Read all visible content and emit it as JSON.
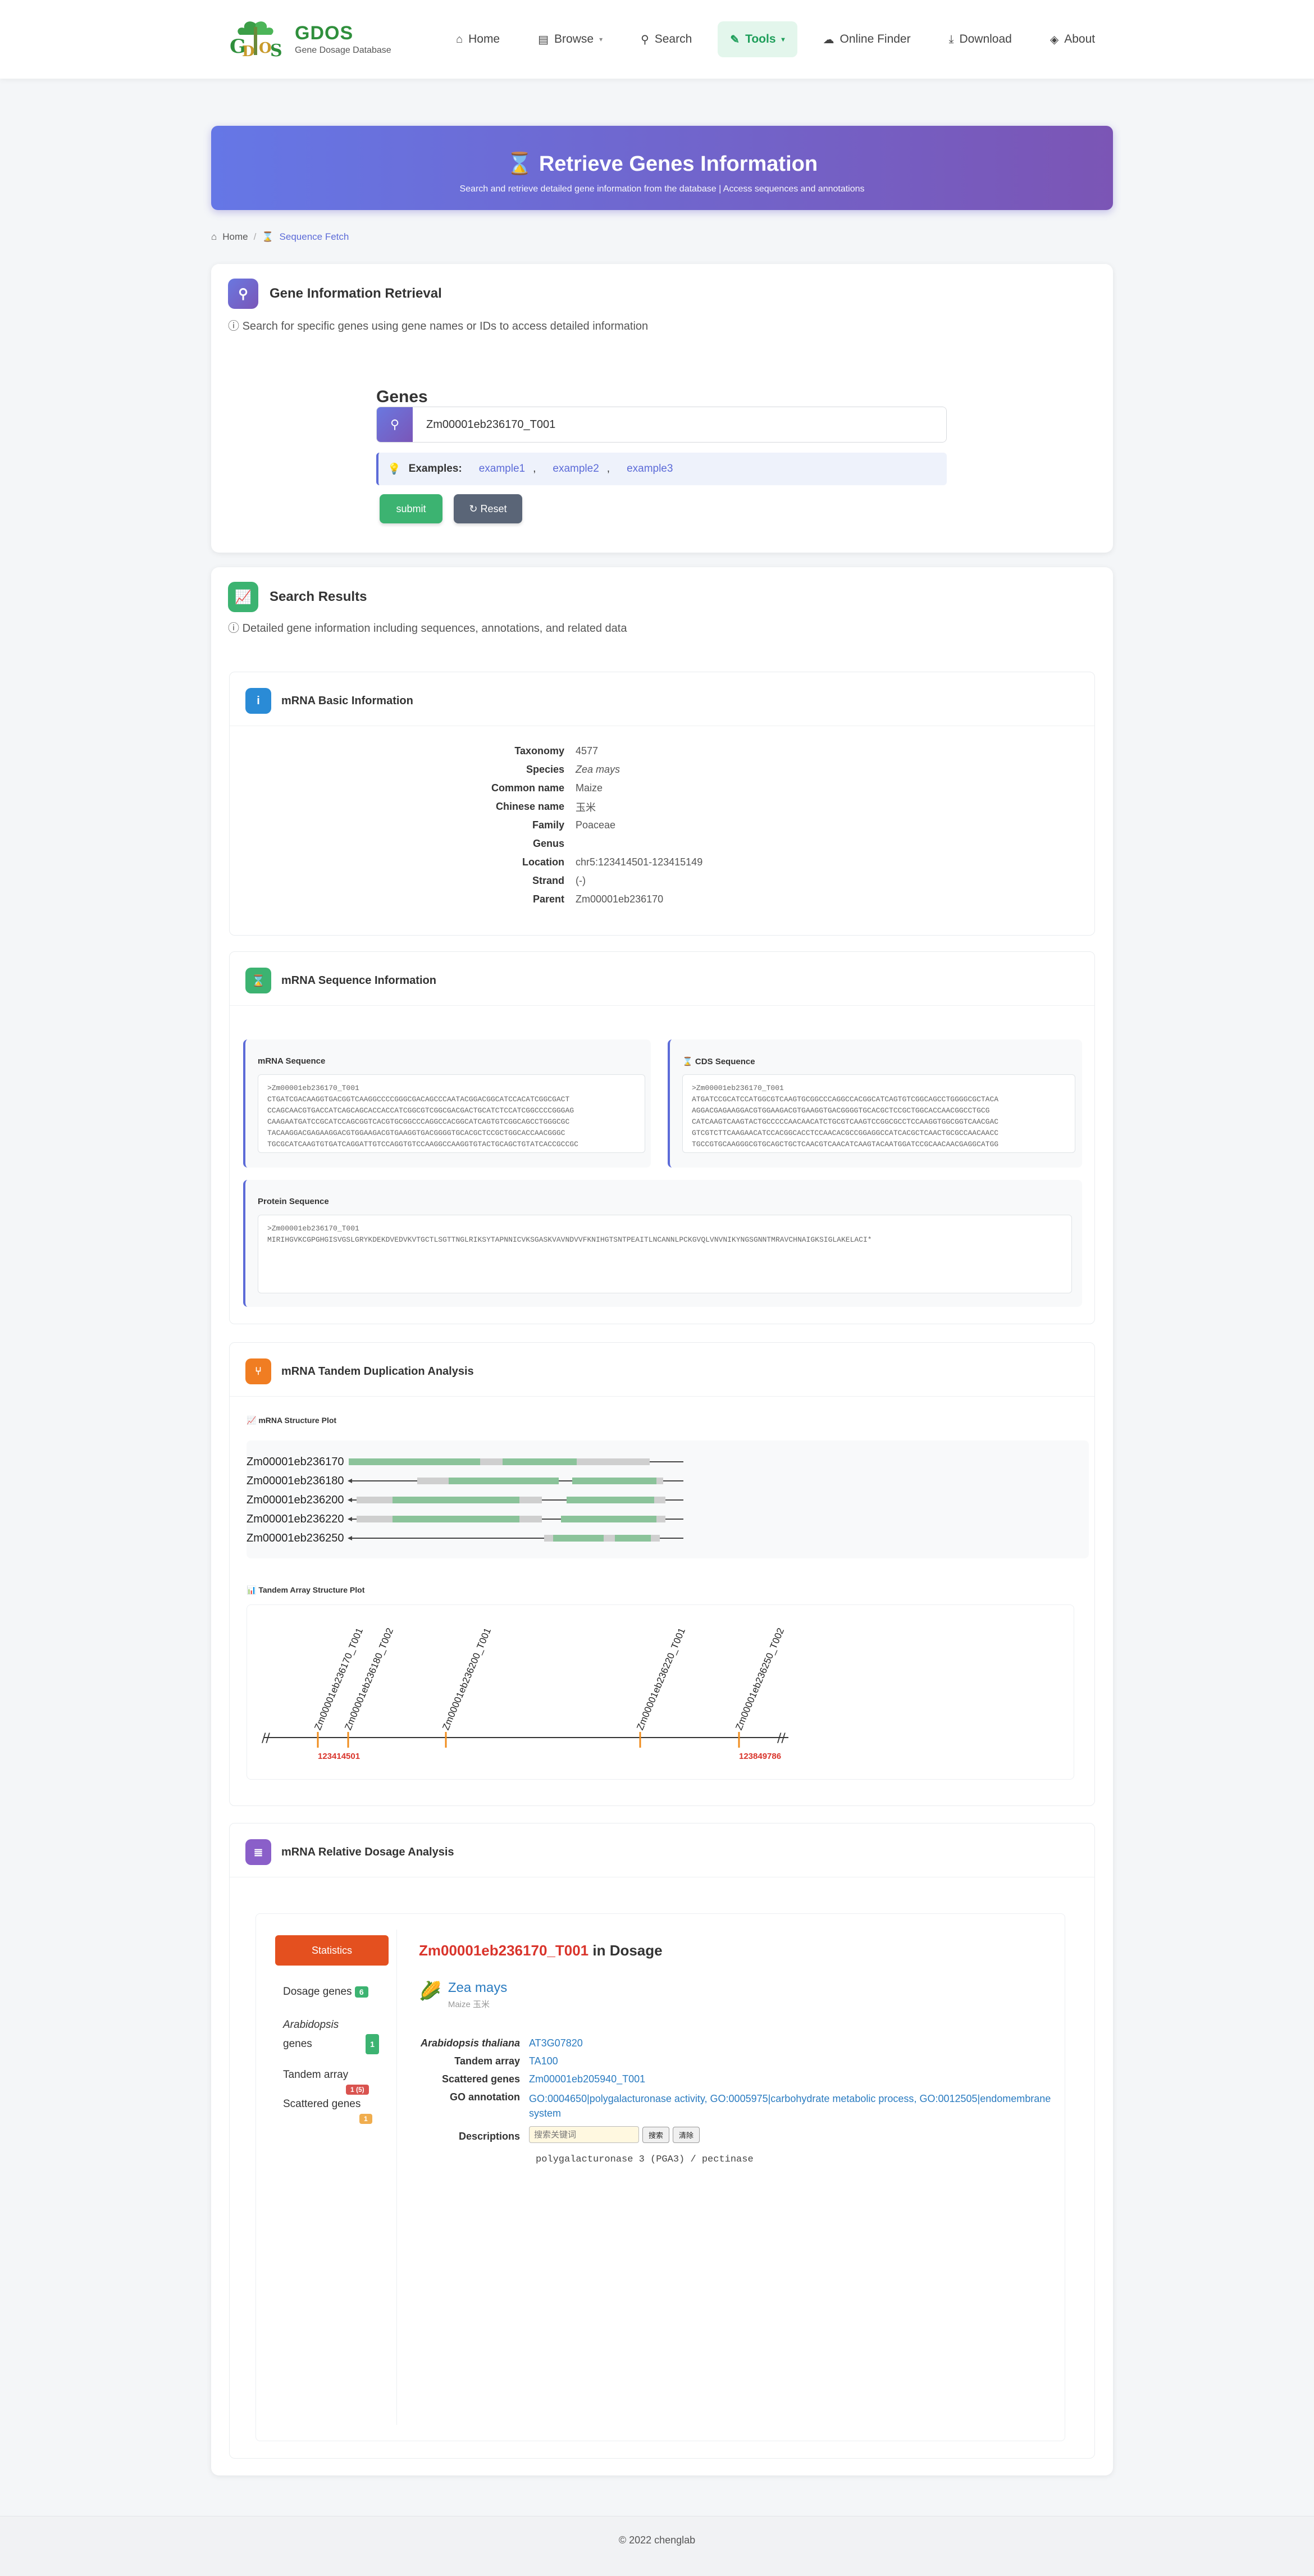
{
  "brand": {
    "title": "GDOS",
    "subtitle": "Gene Dosage Database"
  },
  "nav": [
    {
      "label": "Home",
      "icon": "home-icon"
    },
    {
      "label": "Browse",
      "icon": "book-icon"
    },
    {
      "label": "Search",
      "icon": "search-icon"
    },
    {
      "label": "Tools",
      "icon": "wrench-icon"
    },
    {
      "label": "Online Finder",
      "icon": "cloud-icon"
    },
    {
      "label": "Download",
      "icon": "download-icon"
    },
    {
      "label": "About",
      "icon": "cube-icon"
    }
  ],
  "hero": {
    "title": "Retrieve Genes Information",
    "subtitle": "Search and retrieve detailed gene information from the database | Access sequences and annotations"
  },
  "breadcrumb": {
    "home": "Home",
    "current": "Sequence Fetch"
  },
  "retrieval": {
    "title": "Gene Information Retrieval",
    "desc": "Search for specific genes using gene names or IDs to access detailed information",
    "genes_label": "Genes",
    "input_value": "Zm00001eb236170_T001",
    "examples_label": "Examples:",
    "examples": [
      "example1",
      "example2",
      "example3"
    ],
    "submit": "submit",
    "reset": "Reset"
  },
  "results": {
    "title": "Search Results",
    "desc": "Detailed gene information including sequences, annotations, and related data"
  },
  "basic": {
    "title": "mRNA Basic Information",
    "rows": [
      {
        "k": "Taxonomy",
        "v": "4577"
      },
      {
        "k": "Species",
        "v": "Zea mays"
      },
      {
        "k": "Common name",
        "v": "Maize"
      },
      {
        "k": "Chinese name",
        "v": "玉米"
      },
      {
        "k": "Family",
        "v": "Poaceae"
      },
      {
        "k": "Genus",
        "v": ""
      },
      {
        "k": "Location",
        "v": "chr5:123414501-123415149"
      },
      {
        "k": "Strand",
        "v": "(-)"
      },
      {
        "k": "Parent",
        "v": "Zm00001eb236170"
      }
    ]
  },
  "sequence": {
    "title": "mRNA Sequence Information",
    "mrna_title": "mRNA Sequence",
    "mrna_text": ">Zm00001eb236170_T001\nCTGATCGACAAGGTGACGGTCAAGGCCCCGGGCGACAGCCCAATACGGACGGCATCCACATCGGCGACT\nCCAGCAACGTGACCATCAGCAGCACCACCATCGGCGTCGGCGACGACTGCATCTCCATCGGCCCCGGGAG\nCAAGAATGATCCGCATCCAGCGGTCACGTGCGGCCCAGGCCACGGCATCAGTGTCGGCAGCCTGGGCGC\nTACAAGGACGAGAAGGACGTGGAAGACGTGAAGGTGACGGGGTGCACGCTCCGCTGGCACCAACGGGC\nTGCGCATCAAGTGTGATCAGGATTGTCCAGGTGTCCAAGGCCAAGGTGTACTGCAGCTGTATCACCGCCGC",
    "cds_title": "CDS Sequence",
    "cds_text": ">Zm00001eb236170_T001\nATGATCCGCATCCATGGCGTCAAGTGCGGCCCAGGCCACGGCATCAGTGTCGGCAGCCTGGGGCGCTACA\nAGGACGAGAAGGACGTGGAAGACGTGAAGGTGACGGGGTGCACGCTCCGCTGGCACCAACGGCCTGCG\nCATCAAGTCAAGTACTGCCCCCAACAACATCTGCGTCAAGTCCGGCGCCTCCAAGGTGGCGGTCAACGAC\nGTCGTCTTCAAGAACATCCACGGCACCTCCAACACGCCGGAGGCCATCACGCTCAACTGCGCCAACAACC\nTGCCGTGCAAGGGCGTGCAGCTGCTCAACGTCAACATCAAGTACAATGGATCCGCAACAACGAGGCATGG",
    "protein_title": "Protein Sequence",
    "protein_text": ">Zm00001eb236170_T001\nMIRIHGVKCGPGHGISVGSLGRYKDEKDVEDVKVTGCTLSGTTNGLRIKSYTAPNNICVKSGASKVAVNDVVFKNIHGTSNTPEAITLNCANNLPCKGVQLVNVNIKYNGSGNNTMRAVCHNAIGKSIGLAKELACI*"
  },
  "tandem": {
    "title": "mRNA Tandem Duplication Analysis",
    "structure_title": "mRNA Structure Plot",
    "genes": [
      "Zm00001eb236170",
      "Zm00001eb236180",
      "Zm00001eb236200",
      "Zm00001eb236220",
      "Zm00001eb236250"
    ],
    "array_title": "Tandem Array Structure Plot",
    "array_labels": [
      "Zm00001eb236170_T001",
      "Zm00001eb236180_T002",
      "Zm00001eb236200_T001",
      "Zm00001eb236220_T001",
      "Zm00001eb236250_T002"
    ],
    "start": "123414501",
    "end": "123849786"
  },
  "dosage": {
    "title": "mRNA Relative Dosage Analysis",
    "stats_button": "Statistics",
    "stats": [
      {
        "label": "Dosage genes",
        "badge": "6",
        "color": "#3cb371"
      },
      {
        "label_italic": "Arabidopsis",
        "label": "genes",
        "badge": "1",
        "color": "#3cb371"
      },
      {
        "label": "Tandem array",
        "badge": "1 (5)",
        "color": "#d9534f"
      },
      {
        "label": "Scattered genes",
        "badge": "1",
        "color": "#f0ad4e"
      }
    ],
    "heading_gene": "Zm00001eb236170_T001",
    "heading_suffix": "in Dosage",
    "species": "Zea mays",
    "species_sub": "Maize 玉米",
    "rows": [
      {
        "k": "Arabidopsis thaliana",
        "v": "AT3G07820"
      },
      {
        "k": "Tandem array",
        "v": "TA100"
      },
      {
        "k": "Scattered genes",
        "v": "Zm00001eb205940_T001"
      }
    ],
    "go_label": "GO annotation",
    "go": [
      "GO:0004650|polygalacturonase activity",
      "GO:0005975|carbohydrate metabolic process",
      "GO:0012505|endomembrane system"
    ],
    "desc_label": "Descriptions",
    "desc_placeholder": "搜索关键词",
    "search_btn": "搜索",
    "clear_btn": "清除",
    "desc_text": "polygalacturonase 3 (PGA3) / pectinase"
  },
  "footer": "© 2022 chenglab"
}
